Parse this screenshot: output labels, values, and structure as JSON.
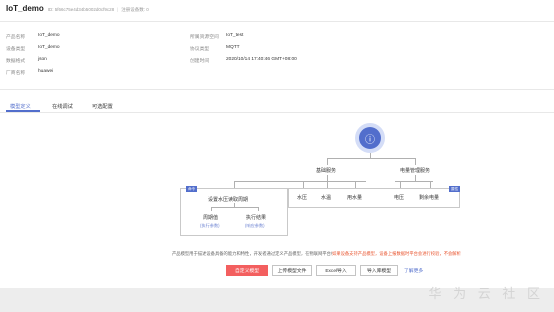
{
  "header": {
    "title": "IoT_demo",
    "id_text": "ID: 5f66c75e4d34b5002d0cf9c28",
    "device_count": "注册设备数: 0"
  },
  "info": {
    "product_name_label": "产品名称",
    "product_name": "IoT_demo",
    "device_type_label": "设备类型",
    "device_type": "IoT_demo",
    "data_format_label": "数据格式",
    "data_format": "json",
    "vendor_label": "厂商名称",
    "vendor": "huawei",
    "resource_space_label": "所属资源空间",
    "resource_space": "IoT_test",
    "protocol_label": "协议类型",
    "protocol": "MQTT",
    "created_label": "创建时间",
    "created": "2020/10/14 17:40:46 GMT+08:00"
  },
  "tabs": [
    "模型定义",
    "在线调试",
    "可选配置"
  ],
  "model_tree": {
    "services": [
      {
        "name": "基础服务",
        "properties": [
          "水压",
          "水温",
          "用水量"
        ]
      },
      {
        "name": "电量管理服务",
        "properties": [
          "电压",
          "剩余电量"
        ]
      }
    ],
    "command": {
      "badge": "命令",
      "name": "设置水压读取周期",
      "params": [
        {
          "name": "周期值",
          "sub": "(执行参数)"
        },
        {
          "name": "执行结果",
          "sub": "(响应参数)"
        }
      ]
    },
    "attr_badge": "属性"
  },
  "description": {
    "normal": "产品模型用于描述设备具备的能力和特性，开发者通过定义产品模型，在物联网平台构建一款设备的抽象模型，使平台理解该款设备支持的服务、属性、命令等信息。",
    "warn": "如果设备支持产品模型，设备上报数据时平台会进行校验，不会解析"
  },
  "buttons": {
    "custom": "自定义模型",
    "upload": "上传模型文件",
    "excel": "Excel导入",
    "import": "导入库模型",
    "learn_more": "了解更多"
  },
  "watermark": "华 为 云 社 区",
  "colors": {
    "accent": "#526ecc",
    "primary_button": "#f35f5f",
    "warn": "#e8542e"
  }
}
